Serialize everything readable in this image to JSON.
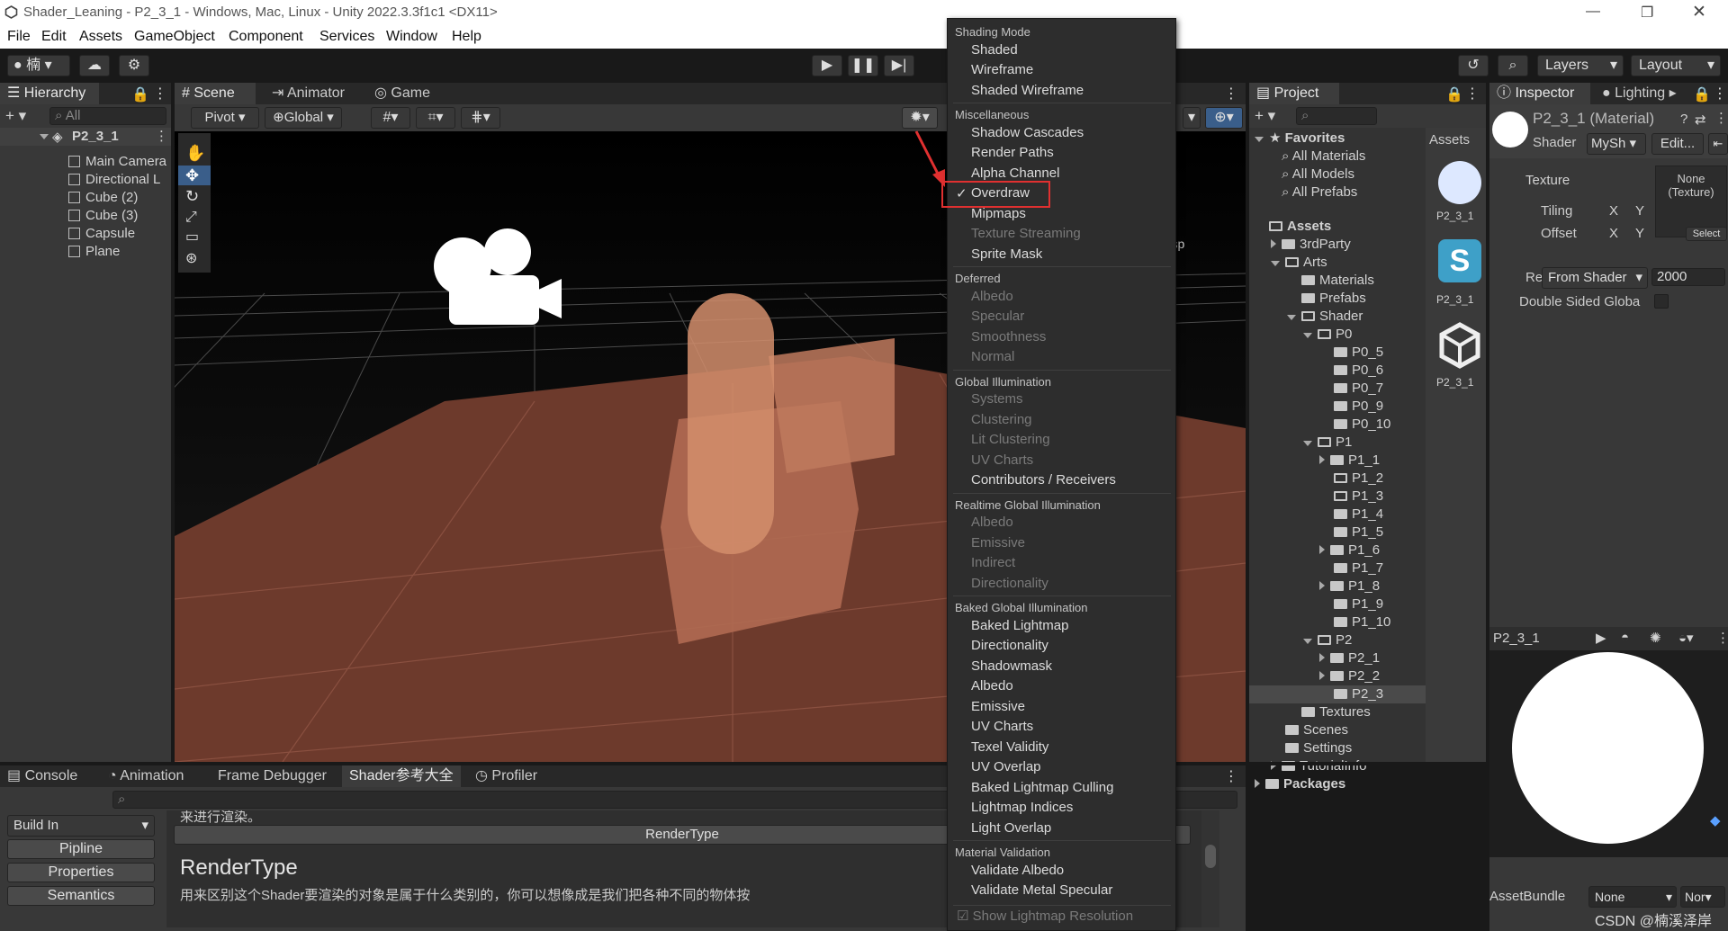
{
  "window": {
    "title": "Shader_Leaning - P2_3_1 - Windows, Mac, Linux - Unity 2022.3.3f1c1 <DX11>"
  },
  "menubar": [
    "File",
    "Edit",
    "Assets",
    "GameObject",
    "Component",
    "Services",
    "Window",
    "Help"
  ],
  "toolbar": {
    "account": "楠",
    "layers": "Layers",
    "layout": "Layout"
  },
  "hierarchy": {
    "tab": "Hierarchy",
    "search_placeholder": "All",
    "scene": "P2_3_1",
    "items": [
      "Main Camera",
      "Directional L",
      "Cube (2)",
      "Cube (3)",
      "Capsule",
      "Plane"
    ]
  },
  "scene": {
    "tabs": [
      "Scene",
      "Animator",
      "Game"
    ],
    "pivot": "Pivot",
    "global": "Global",
    "persp": "ersp"
  },
  "overlay_menu": {
    "groups": [
      {
        "header": "Shading Mode",
        "items": [
          {
            "label": "Shaded",
            "enabled": true
          },
          {
            "label": "Wireframe",
            "enabled": true
          },
          {
            "label": "Shaded Wireframe",
            "enabled": true
          }
        ]
      },
      {
        "header": "Miscellaneous",
        "items": [
          {
            "label": "Shadow Cascades",
            "enabled": true
          },
          {
            "label": "Render Paths",
            "enabled": true
          },
          {
            "label": "Alpha Channel",
            "enabled": true
          },
          {
            "label": "Overdraw",
            "enabled": true,
            "checked": true
          },
          {
            "label": "Mipmaps",
            "enabled": true
          },
          {
            "label": "Texture Streaming",
            "enabled": false
          },
          {
            "label": "Sprite Mask",
            "enabled": true
          }
        ]
      },
      {
        "header": "Deferred",
        "items": [
          {
            "label": "Albedo",
            "enabled": false
          },
          {
            "label": "Specular",
            "enabled": false
          },
          {
            "label": "Smoothness",
            "enabled": false
          },
          {
            "label": "Normal",
            "enabled": false
          }
        ]
      },
      {
        "header": "Global Illumination",
        "items": [
          {
            "label": "Systems",
            "enabled": false
          },
          {
            "label": "Clustering",
            "enabled": false
          },
          {
            "label": "Lit Clustering",
            "enabled": false
          },
          {
            "label": "UV Charts",
            "enabled": false
          },
          {
            "label": "Contributors / Receivers",
            "enabled": true
          }
        ]
      },
      {
        "header": "Realtime Global Illumination",
        "items": [
          {
            "label": "Albedo",
            "enabled": false
          },
          {
            "label": "Emissive",
            "enabled": false
          },
          {
            "label": "Indirect",
            "enabled": false
          },
          {
            "label": "Directionality",
            "enabled": false
          }
        ]
      },
      {
        "header": "Baked Global Illumination",
        "items": [
          {
            "label": "Baked Lightmap",
            "enabled": true
          },
          {
            "label": "Directionality",
            "enabled": true
          },
          {
            "label": "Shadowmask",
            "enabled": true
          },
          {
            "label": "Albedo",
            "enabled": true
          },
          {
            "label": "Emissive",
            "enabled": true
          },
          {
            "label": "UV Charts",
            "enabled": true
          },
          {
            "label": "Texel Validity",
            "enabled": true
          },
          {
            "label": "UV Overlap",
            "enabled": true
          },
          {
            "label": "Baked Lightmap Culling",
            "enabled": true
          },
          {
            "label": "Lightmap Indices",
            "enabled": true
          },
          {
            "label": "Light Overlap",
            "enabled": true
          }
        ]
      },
      {
        "header": "Material Validation",
        "items": [
          {
            "label": "Validate Albedo",
            "enabled": true
          },
          {
            "label": "Validate Metal Specular",
            "enabled": true
          }
        ]
      }
    ],
    "footer": "Show Lightmap Resolution"
  },
  "project": {
    "tab": "Project",
    "favorites": "Favorites",
    "fav_items": [
      "All Materials",
      "All Models",
      "All Prefabs"
    ],
    "tree": [
      {
        "label": "Assets",
        "depth": 0,
        "bold": true,
        "open": true
      },
      {
        "label": "3rdParty",
        "depth": 1,
        "arrow": "right"
      },
      {
        "label": "Arts",
        "depth": 1,
        "arrow": "down",
        "open": true
      },
      {
        "label": "Materials",
        "depth": 2
      },
      {
        "label": "Prefabs",
        "depth": 2
      },
      {
        "label": "Shader",
        "depth": 2,
        "arrow": "down",
        "open": true
      },
      {
        "label": "P0",
        "depth": 3,
        "arrow": "down",
        "open": true
      },
      {
        "label": "P0_5",
        "depth": 4
      },
      {
        "label": "P0_6",
        "depth": 4
      },
      {
        "label": "P0_7",
        "depth": 4
      },
      {
        "label": "P0_9",
        "depth": 4
      },
      {
        "label": "P0_10",
        "depth": 4
      },
      {
        "label": "P1",
        "depth": 3,
        "arrow": "down",
        "open": true
      },
      {
        "label": "P1_1",
        "depth": 4,
        "arrow": "right"
      },
      {
        "label": "P1_2",
        "depth": 4,
        "open": true
      },
      {
        "label": "P1_3",
        "depth": 4,
        "open": true
      },
      {
        "label": "P1_4",
        "depth": 4
      },
      {
        "label": "P1_5",
        "depth": 4
      },
      {
        "label": "P1_6",
        "depth": 4,
        "arrow": "right"
      },
      {
        "label": "P1_7",
        "depth": 4
      },
      {
        "label": "P1_8",
        "depth": 4,
        "arrow": "right"
      },
      {
        "label": "P1_9",
        "depth": 4
      },
      {
        "label": "P1_10",
        "depth": 4
      },
      {
        "label": "P2",
        "depth": 3,
        "arrow": "down",
        "open": true
      },
      {
        "label": "P2_1",
        "depth": 4,
        "arrow": "right"
      },
      {
        "label": "P2_2",
        "depth": 4,
        "arrow": "right"
      },
      {
        "label": "P2_3",
        "depth": 4,
        "selected": true
      },
      {
        "label": "Textures",
        "depth": 2
      },
      {
        "label": "Scenes",
        "depth": 1
      },
      {
        "label": "Settings",
        "depth": 1
      },
      {
        "label": "TutorialInfo",
        "depth": 1,
        "arrow": "right"
      },
      {
        "label": "Packages",
        "depth": 0,
        "bold": true,
        "arrow": "right"
      }
    ],
    "assets_label": "Assets",
    "asset_items": [
      "P2_3_1",
      "P2_3_1",
      "P2_3_1"
    ]
  },
  "inspector": {
    "tab": "Inspector",
    "lighting_tab": "Lighting",
    "material_name": "P2_3_1 (Material)",
    "shader_label": "Shader",
    "shader_value": "MySh",
    "edit_btn": "Edit...",
    "texture_label": "Texture",
    "texture_slot": "None (Texture)",
    "select_btn": "Select",
    "tiling": "Tiling",
    "offset": "Offset",
    "x": "X",
    "y": "Y",
    "rq_label": "Re",
    "rq_dropdown": "From Shader",
    "rq_value": "2000",
    "double_sided": "Double Sided Globa",
    "preview_name": "P2_3_1",
    "assetbundle_label": "AssetBundle",
    "assetbundle_value": "None",
    "assetbundle_variant": "Nor"
  },
  "bottom": {
    "tabs": [
      "Console",
      "Animation",
      "Frame Debugger",
      "Shader参考大全",
      "Profiler"
    ],
    "buildin": "Build In",
    "side_buttons": [
      "Pipline",
      "Properties",
      "Semantics"
    ],
    "rendertype_btn": "RenderType",
    "heading": "RenderType",
    "body_text": "用来区别这个Shader要渲染的对象是属于什么类别的，你可以想像成是我们把各种不同的物体按",
    "top_text": "来进行渲染。"
  },
  "watermark": "CSDN @楠溪泽岸"
}
